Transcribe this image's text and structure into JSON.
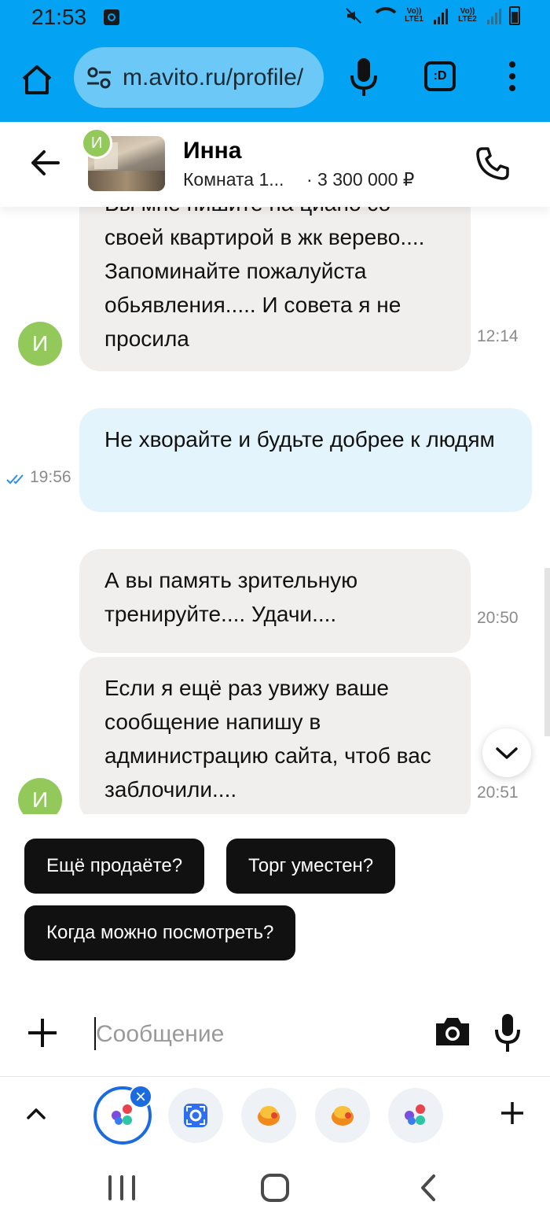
{
  "status_bar": {
    "time": "21:53",
    "sim1": "Vo)) LTE1",
    "sim2": "Vo)) LTE2"
  },
  "browser": {
    "url": "m.avito.ru/profile/",
    "tabs_label": ":D"
  },
  "chat": {
    "contact_avatar_letter": "И",
    "contact_name": "Инна",
    "listing_title": "Комната 1...",
    "listing_price": "· 3 300 000 ₽"
  },
  "messages": [
    {
      "direction": "in",
      "text": "Вы мне пишите на циано со своей квартирой в жк верево.... Запоминайте пожалуйста обьявления..... И совета я не просила",
      "time": "12:14"
    },
    {
      "direction": "out",
      "text": "Не хворайте и будьте добрее к людям",
      "time": "19:56",
      "read": true
    },
    {
      "direction": "in",
      "text": "А вы память зрительную тренируйте.... Удачи....",
      "time": "20:50"
    },
    {
      "direction": "in",
      "text": "Если я ещё раз увижу ваше сообщение напишу в администрацию сайта, чтоб вас заблочили....",
      "time": "20:51"
    }
  ],
  "quick_replies": [
    "Ещё продаёте?",
    "Торг уместен?",
    "Когда можно посмотреть?"
  ],
  "input": {
    "placeholder": "Сообщение",
    "value": ""
  },
  "tray": {
    "apps": [
      "assistant-app",
      "lens-app",
      "avito-app",
      "avito-app-2",
      "assistant-app-2"
    ],
    "close_label": "×"
  },
  "colors": {
    "browser_bar": "#04a2f3",
    "incoming_bubble": "#f1efed",
    "outgoing_bubble": "#e4f4fd",
    "avatar": "#93c95b",
    "quick_reply": "#111111"
  }
}
